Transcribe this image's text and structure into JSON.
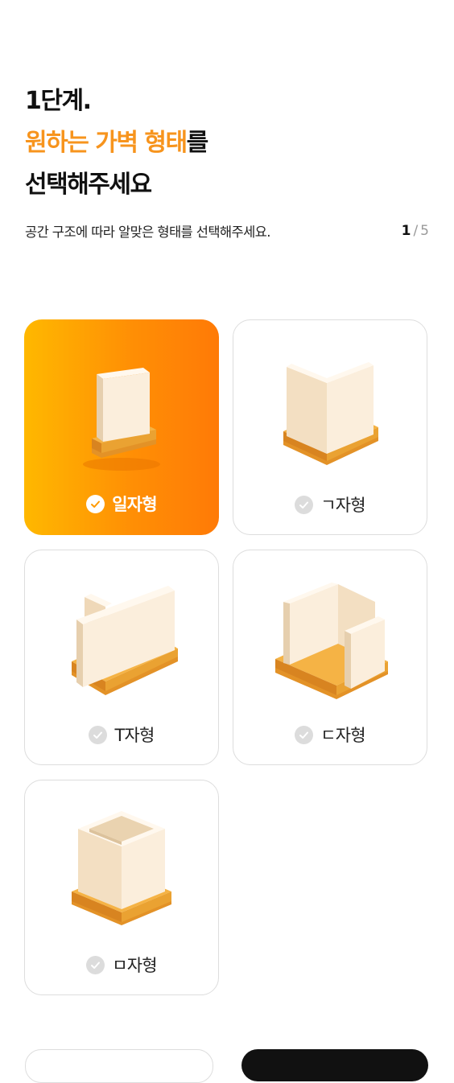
{
  "header": {
    "step": "1단계.",
    "line2_highlight": "원하는 가벽 형태",
    "line2_rest": "를",
    "line3": "선택해주세요",
    "subtitle": "공간 구조에 따라 알맞은 형태를 선택해주세요.",
    "progress_current": "1",
    "progress_separator": "/",
    "progress_total": "5"
  },
  "options": [
    {
      "label": "일자형",
      "selected": true
    },
    {
      "label": "ㄱ자형",
      "selected": false
    },
    {
      "label": "T자형",
      "selected": false
    },
    {
      "label": "ㄷ자형",
      "selected": false
    },
    {
      "label": "ㅁ자형",
      "selected": false
    }
  ],
  "colors": {
    "accent": "#f7941d",
    "selected_gradient_start": "#ffb800",
    "selected_gradient_end": "#ff7a06",
    "wall": "#fbeedc",
    "base": "#f0a436"
  }
}
